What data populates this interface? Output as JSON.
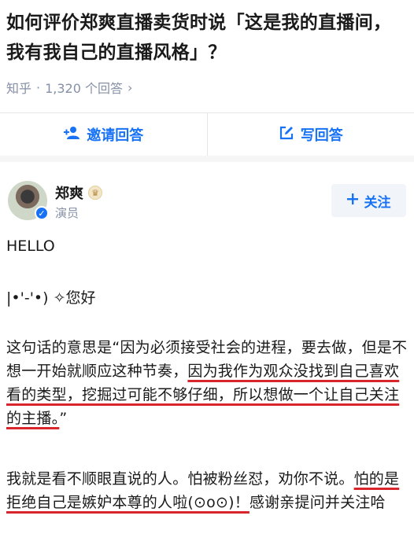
{
  "question": {
    "title": "如何评价郑爽直播卖货时说「这是我的直播间，我有我自己的直播风格」？",
    "source": "知乎",
    "answer_count": "1,320 个回答"
  },
  "actions": {
    "invite_label": "邀请回答",
    "write_label": "写回答"
  },
  "author": {
    "name": "郑爽",
    "title": "演员",
    "follow_label": "关注"
  },
  "answer": {
    "p1": "HELLO",
    "p2": "|•'-'•) ✧您好",
    "p3_a": "这句话的意思是“因为必须接受社会的进程，要去做，但是不想一开始就顺应这种节奏，",
    "p3_b": "因为我作为观众没找到自己喜欢看的类型，挖掘过可能不够仔细，所以想做一个让自己关注的主播。",
    "p3_c": "”",
    "p4_a": "我就是看不顺眼直说的人。怕被粉丝怼，劝你不说。",
    "p4_b": "怕的是拒绝自己是嫉妒本尊的人啦(⊙o⊙)！",
    "p4_c": "感谢亲提问并关注哈"
  },
  "colors": {
    "accent": "#1772f6",
    "underline": "#d9262c",
    "meta": "#8590a6"
  },
  "icons": [
    "invite-icon",
    "edit-icon",
    "plus-icon",
    "verified-icon",
    "level-badge-icon",
    "chevron-right-icon"
  ]
}
